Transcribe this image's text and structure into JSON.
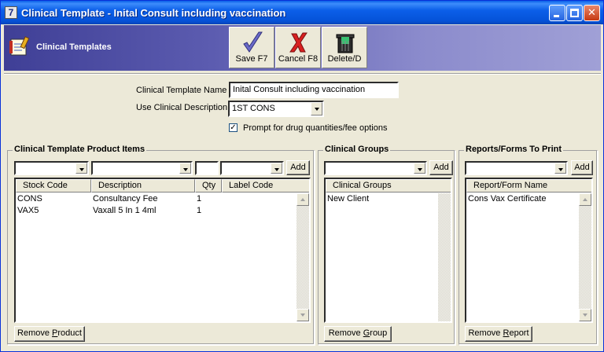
{
  "window": {
    "app_icon": "7",
    "title": "Clinical Template - Inital Consult including vaccination",
    "controls": [
      "minimize-icon",
      "maximize-icon",
      "close-icon"
    ]
  },
  "header": {
    "title": "Clinical Templates",
    "icon": "notepad-icon",
    "toolbar": [
      {
        "label": "Save F7",
        "icon": "checkmark-icon"
      },
      {
        "label": "Cancel F8",
        "icon": "red-x-icon"
      },
      {
        "label": "Delete/D",
        "icon": "trash-can-icon"
      }
    ]
  },
  "form": {
    "name_label": "Clinical Template Name",
    "name_value": "Inital Consult including vaccination",
    "desc_label": "Use Clinical Description",
    "desc_value": "1ST CONS",
    "prompt_label": "Prompt for drug quantities/fee options",
    "prompt_checked": true
  },
  "products": {
    "title": "Clinical Template Product Items",
    "add_label": "Add",
    "columns": [
      "Stock Code",
      "Description",
      "Qty",
      "Label Code"
    ],
    "rows": [
      [
        "CONS",
        "Consultancy Fee",
        "1",
        ""
      ],
      [
        "VAX5",
        "Vaxall 5 In 1 4ml",
        "1",
        ""
      ]
    ],
    "remove_pre": "Remove ",
    "remove_key": "P",
    "remove_post": "roduct"
  },
  "groups": {
    "title": "Clinical Groups",
    "add_label": "Add",
    "column": "Clinical Groups",
    "rows": [
      "New Client"
    ],
    "remove_pre": "Remove ",
    "remove_key": "G",
    "remove_post": "roup"
  },
  "reports": {
    "title": "Reports/Forms To Print",
    "add_label": "Add",
    "column": "Report/Form Name",
    "rows": [
      "Cons Vax Certificate"
    ],
    "remove_pre": "Remove ",
    "remove_key": "R",
    "remove_post": "eport"
  },
  "colors": {
    "title_bar": "#0a5ee8",
    "header_band": "#5c5cb0",
    "face": "#ece9d8"
  }
}
